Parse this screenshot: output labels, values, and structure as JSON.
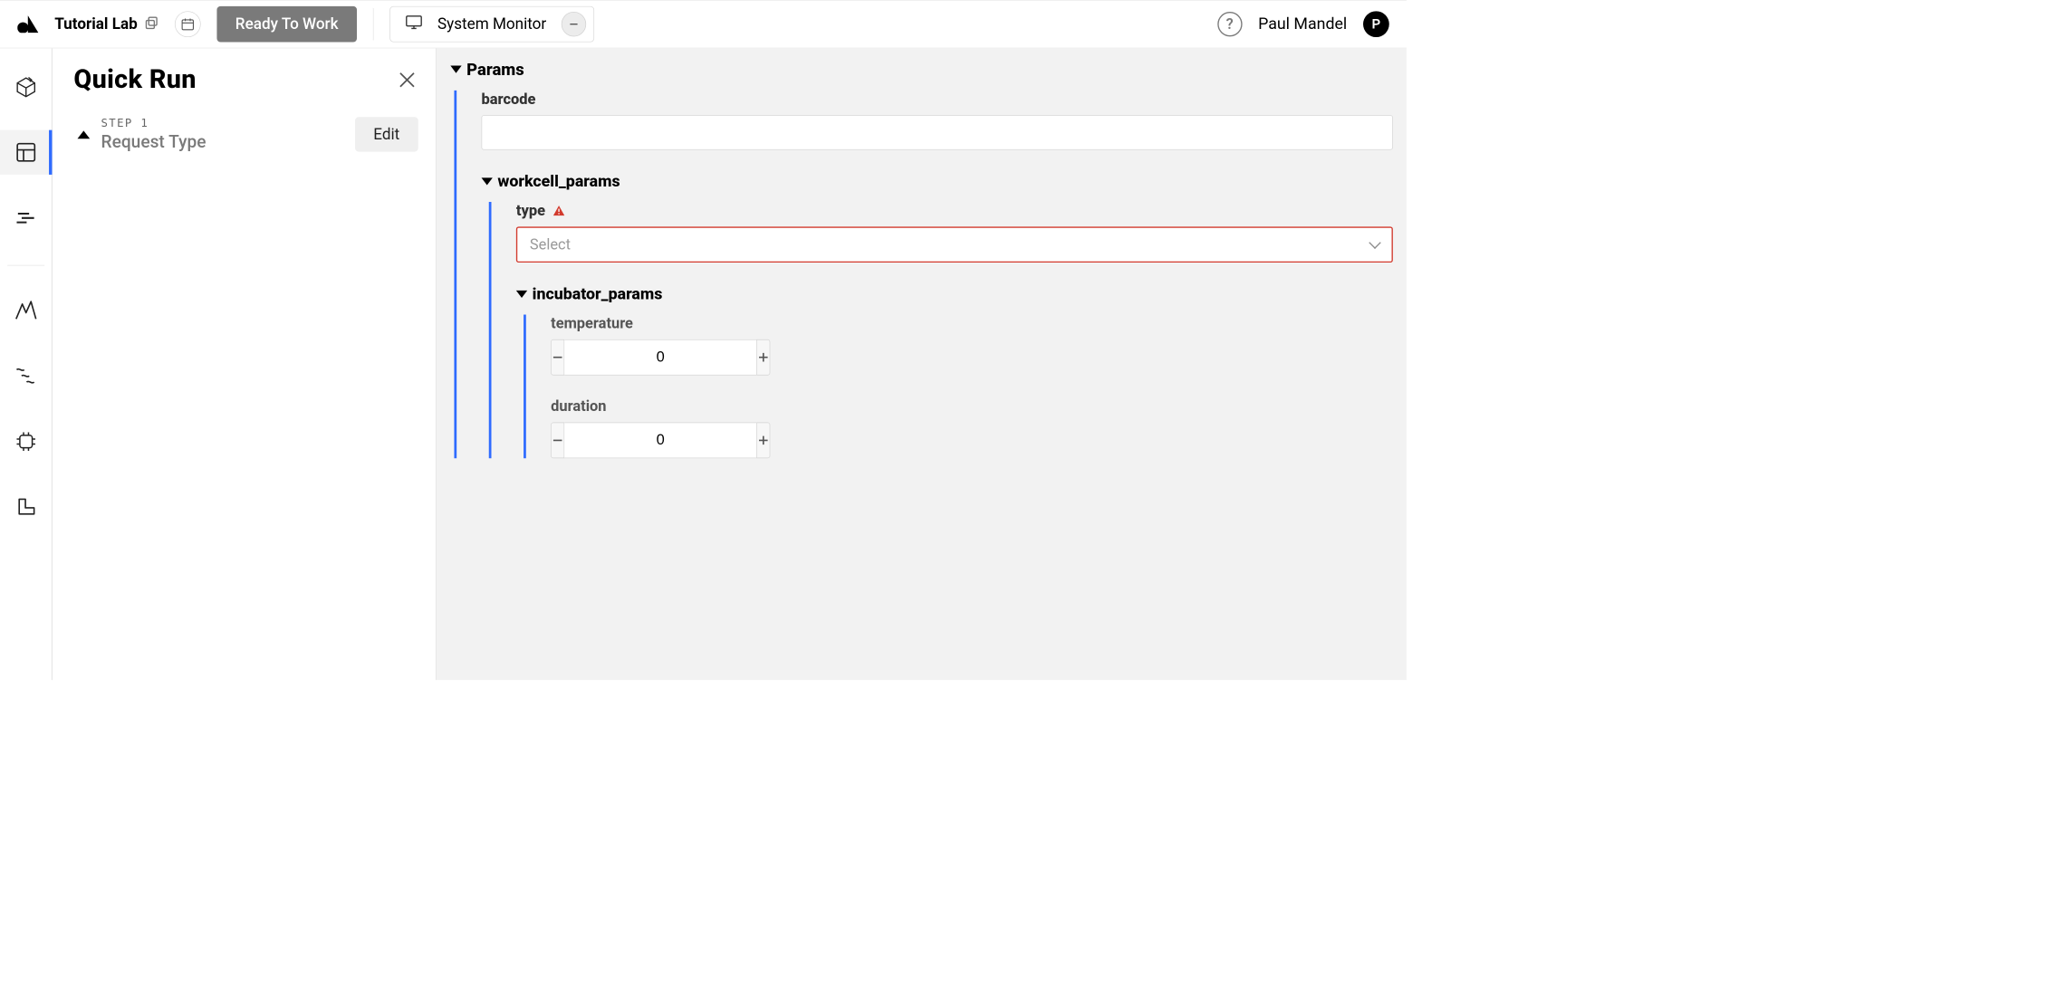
{
  "topbar": {
    "lab_name": "Tutorial Lab",
    "status_pill": "Ready To Work",
    "system_monitor": "System Monitor",
    "help_glyph": "?",
    "user_name": "Paul Mandel",
    "avatar_initial": "P"
  },
  "quickrun": {
    "title": "Quick Run",
    "step_badge": "STEP 1",
    "step_label": "Request Type",
    "edit_label": "Edit"
  },
  "params": {
    "section_title": "Params",
    "barcode": {
      "label": "barcode",
      "value": ""
    },
    "workcell_params": {
      "title": "workcell_params",
      "type": {
        "label": "type",
        "placeholder": "Select",
        "has_error": true
      },
      "incubator_params": {
        "title": "incubator_params",
        "temperature": {
          "label": "temperature",
          "value": "0"
        },
        "duration": {
          "label": "duration",
          "value": "0"
        }
      }
    }
  }
}
